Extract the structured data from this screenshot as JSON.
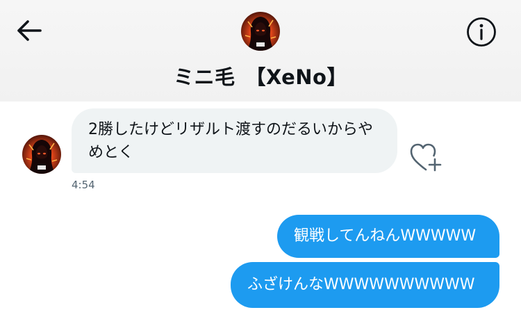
{
  "header": {
    "title": "ミニ毛　【XeNo】",
    "back_icon": "arrow-left-icon",
    "info_icon": "info-icon"
  },
  "messages": [
    {
      "direction": "incoming",
      "text": "2勝したけどリザルト渡すのだるいからやめとく",
      "time": "4:54"
    },
    {
      "direction": "outgoing",
      "text": "観戦してんねんWWWWW"
    },
    {
      "direction": "outgoing",
      "text": "ふざけんなWWWWWWWWWW"
    }
  ],
  "icons": {
    "like": "heart-plus-icon"
  },
  "colors": {
    "header_bg": "#f3f3f3",
    "incoming_bubble": "#eff3f4",
    "outgoing_bubble": "#1d9bf0",
    "timestamp": "#536471",
    "text": "#0f1419"
  }
}
